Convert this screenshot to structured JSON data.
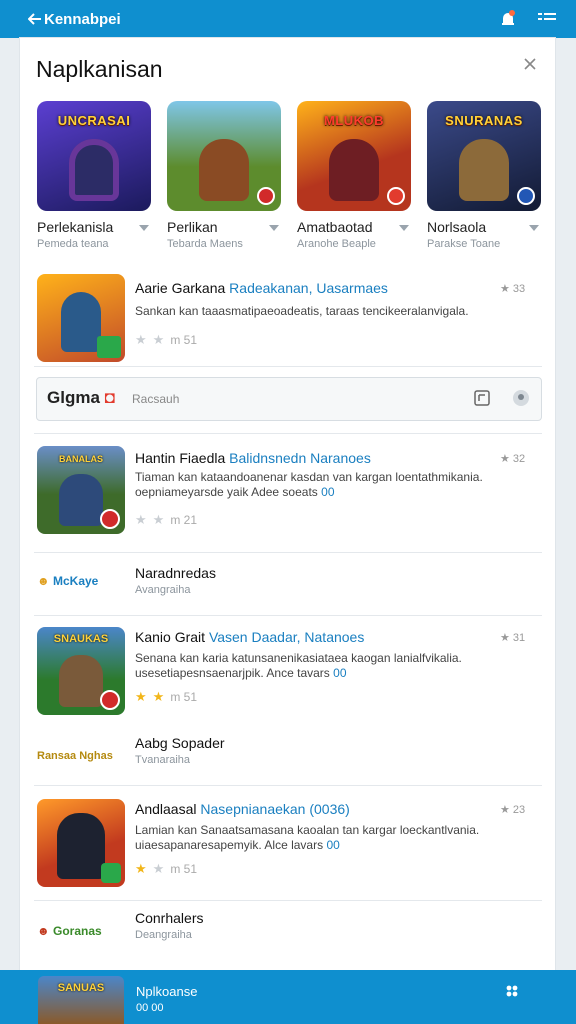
{
  "topbar": {
    "brand": "Kennabpei"
  },
  "panel": {
    "title": "Naplkanisan"
  },
  "apps": [
    {
      "name": "Perlekanisla",
      "sub": "Pemeda teana",
      "thumb_text": "UNCRASAI",
      "bg": "#3b2f8f",
      "accent": "#e24bff"
    },
    {
      "name": "Perlikan",
      "sub": "Tebarda Maens",
      "thumb_text": "",
      "bg": "#5d8c2d",
      "accent": "#c0392b"
    },
    {
      "name": "Amatbaotad",
      "sub": "Aranohe Beaple",
      "thumb_text": "MLUKOB",
      "bg": "#b5351e",
      "accent": "#ffb21a"
    },
    {
      "name": "Norlsaola",
      "sub": "Parakse Toane",
      "thumb_text": "SNURANAS",
      "bg": "#1e2a54",
      "accent": "#c9a254"
    }
  ],
  "rows": [
    {
      "title": "Aarie Garkana",
      "sub": "Radeakanan, Uasarmaes",
      "desc": "Sankan kan taaasmatipaeoadeatis, taraas tencikeeralanvigala.",
      "link": "",
      "score": "33",
      "rating": "m   51",
      "stars": 0,
      "bg": "#c14a2a"
    },
    {
      "title": "Hantin Fiaedla",
      "sub": "Balidnsnedn Naranoes",
      "desc": "Tiaman kan kataandoanenar kasdan van kargan loentathmikania. oepniameyarsde yaik Adee soeats",
      "link": "00",
      "score": "32",
      "rating": "m   21",
      "stars": 0,
      "bg": "#3e6b2a"
    },
    {
      "title": "Kanio Grait",
      "sub": "Vasen Daadar, Natanoes",
      "desc": "Senana kan karia katunsanenikasiataea kaogan lanialfvikalia. usesetiapesnsaenarjpik. Ance tavars",
      "link": "00",
      "score": "31",
      "rating": "m   51",
      "stars": 2,
      "bg": "#2c7a2c"
    },
    {
      "title": "Andlaasal",
      "sub": "Nasepnianaekan (0036)",
      "desc": "Lamian kan Sanaatsamasana kaoalan tan kargar loeckantlvania. uiaesapanaresapemyik. Alce lavars",
      "link": "00",
      "score": "23",
      "rating": "m   51",
      "stars": 1,
      "bg": "#c23a1f"
    }
  ],
  "search": {
    "logo": "Glgma",
    "placeholder": "Racsauh"
  },
  "minis": [
    {
      "logo": "McKaye",
      "title": "Naradnredas",
      "sub": "Avangraiha"
    },
    {
      "logo": "Ransaa Nghas",
      "title": "Aabg Sopader",
      "sub": "Tvanaraiha"
    },
    {
      "logo": "Goranas",
      "title": "Conrhalers",
      "sub": "Deangraiha"
    }
  ],
  "bottombar": {
    "title": "Nplkoanse",
    "sub": "00 00"
  }
}
